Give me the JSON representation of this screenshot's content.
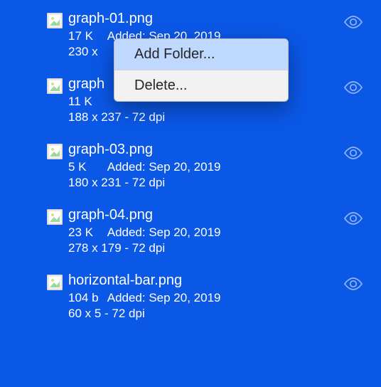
{
  "files": [
    {
      "name": "graph-01.png",
      "size": "17 K",
      "added": "Added: Sep 20, 2019",
      "dims": "230 x"
    },
    {
      "name": "graph",
      "size": "11 K",
      "added": "",
      "dims": "188 x 237 - 72 dpi"
    },
    {
      "name": "graph-03.png",
      "size": "5 K",
      "added": "Added: Sep 20, 2019",
      "dims": "180 x 231 - 72 dpi"
    },
    {
      "name": "graph-04.png",
      "size": "23 K",
      "added": "Added: Sep 20, 2019",
      "dims": "278 x 179 - 72 dpi"
    },
    {
      "name": "horizontal-bar.png",
      "size": "104 b",
      "added": "Added: Sep 20, 2019",
      "dims": "60 x 5 - 72 dpi"
    }
  ],
  "context_menu": {
    "add_folder": "Add Folder...",
    "delete": "Delete..."
  }
}
